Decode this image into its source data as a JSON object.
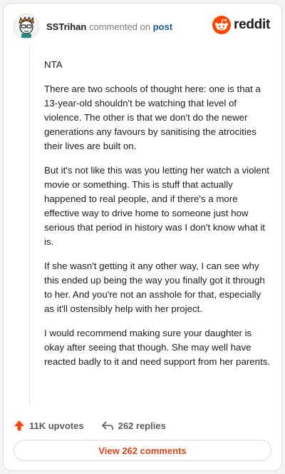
{
  "header": {
    "username": "SSTrihan",
    "action_text": "commented on",
    "post_link": "post",
    "brand": "reddit"
  },
  "comment": {
    "paragraphs": [
      "NTA",
      "There are two schools of thought here: one is that a 13-year-old shouldn't be watching that level of violence. The other is that we don't do the newer generations any favours by sanitising the atrocities their lives are built on.",
      "But it's not like this was you letting her watch a violent movie or something. This is stuff that actually happened to real people, and if there's a more effective way to drive home to someone just how serious that period in history was I don't know what it is.",
      "If she wasn't getting it any other way, I can see why this ended up being the way you finally got it through to her. And you're not an asshole for that, especially as it'll ostensibly help with her project.",
      "I would recommend making sure your daughter is okay after seeing that though. She may well have reacted badly to it and need support from her parents."
    ]
  },
  "footer": {
    "upvotes": "11K upvotes",
    "replies": "262 replies",
    "view_button": "View 262 comments"
  },
  "colors": {
    "accent": "#ff4500",
    "link": "#1a5c8c",
    "button_text": "#d4471d"
  }
}
